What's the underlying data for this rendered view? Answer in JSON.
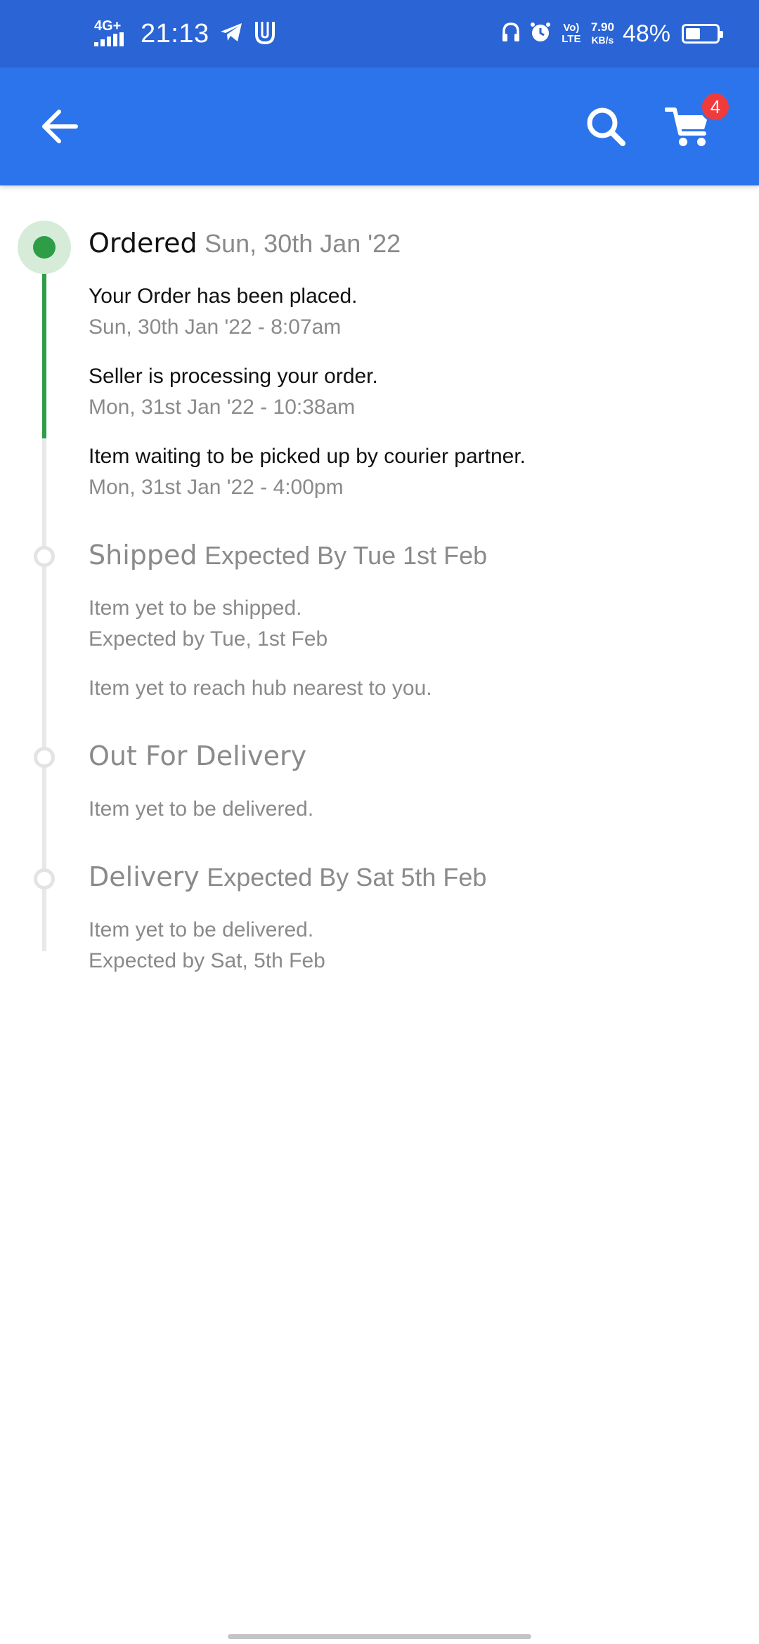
{
  "status_bar": {
    "network": "4G+",
    "time": "21:13",
    "speed_value": "7.90",
    "speed_unit": "KB/s",
    "volte": "Vo) LTE",
    "battery_percent": "48%",
    "battery_level": 0.48,
    "icons": [
      "signal-icon",
      "telegram-icon",
      "app-u-icon",
      "headphones-icon",
      "alarm-icon",
      "volte-icon",
      "battery-icon"
    ]
  },
  "app_bar": {
    "back_icon": "arrow-left-icon",
    "search_icon": "search-icon",
    "cart_icon": "cart-icon",
    "cart_count": "4",
    "color": "#2c74ec",
    "badge_color": "#ef3b3b"
  },
  "timeline": {
    "active_color": "#2e9e46",
    "stages": [
      {
        "name": "Ordered",
        "subtitle": "Sun, 30th Jan '22",
        "status": "done",
        "events": [
          {
            "text": "Your Order has been placed.",
            "time": "Sun, 30th Jan '22 - 8:07am"
          },
          {
            "text": "Seller is processing your order.",
            "time": "Mon, 31st Jan '22 - 10:38am"
          },
          {
            "text": "Item waiting to be picked up by courier partner.",
            "time": "Mon, 31st Jan '22 - 4:00pm"
          }
        ]
      },
      {
        "name": "Shipped",
        "subtitle": "Expected By Tue 1st Feb",
        "status": "pending",
        "events": [
          {
            "text": "Item yet to be shipped.",
            "time": "Expected by Tue, 1st Feb"
          },
          {
            "text": "Item yet to reach hub nearest to you."
          }
        ]
      },
      {
        "name": "Out For Delivery",
        "subtitle": "",
        "status": "pending",
        "events": [
          {
            "text": "Item yet to be delivered."
          }
        ]
      },
      {
        "name": "Delivery",
        "subtitle": "Expected By Sat 5th Feb",
        "status": "pending",
        "events": [
          {
            "text": "Item yet to be delivered.",
            "time": "Expected by Sat, 5th Feb"
          }
        ]
      }
    ]
  }
}
